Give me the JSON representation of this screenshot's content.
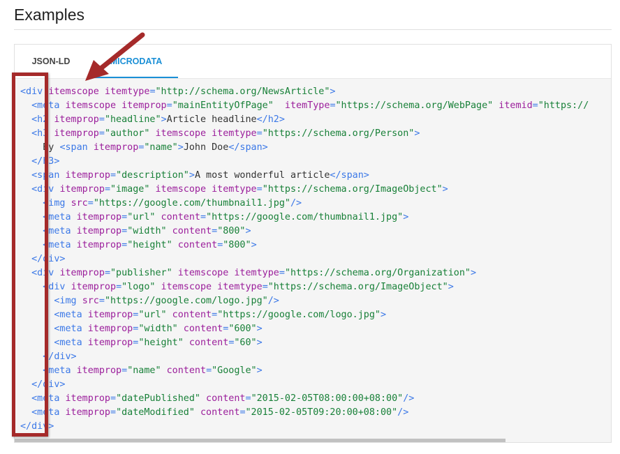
{
  "page": {
    "heading": "Examples"
  },
  "tabs": [
    {
      "label": "JSON-LD",
      "active": false
    },
    {
      "label": "MICRODATA",
      "active": true
    }
  ],
  "code_lines": [
    [
      {
        "c": "tg",
        "t": "<div "
      },
      {
        "c": "at",
        "t": "itemscope itemtype"
      },
      {
        "c": "tg",
        "t": "="
      },
      {
        "c": "vl",
        "t": "\"http://schema.org/NewsArticle\""
      },
      {
        "c": "tg",
        "t": ">"
      }
    ],
    [
      {
        "c": "tg",
        "t": "  <meta "
      },
      {
        "c": "at",
        "t": "itemscope itemprop"
      },
      {
        "c": "tg",
        "t": "="
      },
      {
        "c": "vl",
        "t": "\"mainEntityOfPage\""
      },
      {
        "c": "at",
        "t": "  itemType"
      },
      {
        "c": "tg",
        "t": "="
      },
      {
        "c": "vl",
        "t": "\"https://schema.org/WebPage\""
      },
      {
        "c": "at",
        "t": " itemid"
      },
      {
        "c": "tg",
        "t": "="
      },
      {
        "c": "vl",
        "t": "\"https://"
      }
    ],
    [
      {
        "c": "tg",
        "t": "  <h2 "
      },
      {
        "c": "at",
        "t": "itemprop"
      },
      {
        "c": "tg",
        "t": "="
      },
      {
        "c": "vl",
        "t": "\"headline\""
      },
      {
        "c": "tg",
        "t": ">"
      },
      {
        "c": "",
        "t": "Article headline"
      },
      {
        "c": "tg",
        "t": "</h2>"
      }
    ],
    [
      {
        "c": "tg",
        "t": "  <h3 "
      },
      {
        "c": "at",
        "t": "itemprop"
      },
      {
        "c": "tg",
        "t": "="
      },
      {
        "c": "vl",
        "t": "\"author\""
      },
      {
        "c": "at",
        "t": " itemscope itemtype"
      },
      {
        "c": "tg",
        "t": "="
      },
      {
        "c": "vl",
        "t": "\"https://schema.org/Person\""
      },
      {
        "c": "tg",
        "t": ">"
      }
    ],
    [
      {
        "c": "",
        "t": "    By "
      },
      {
        "c": "tg",
        "t": "<span "
      },
      {
        "c": "at",
        "t": "itemprop"
      },
      {
        "c": "tg",
        "t": "="
      },
      {
        "c": "vl",
        "t": "\"name\""
      },
      {
        "c": "tg",
        "t": ">"
      },
      {
        "c": "",
        "t": "John Doe"
      },
      {
        "c": "tg",
        "t": "</span>"
      }
    ],
    [
      {
        "c": "tg",
        "t": "  </h3>"
      }
    ],
    [
      {
        "c": "tg",
        "t": "  <span "
      },
      {
        "c": "at",
        "t": "itemprop"
      },
      {
        "c": "tg",
        "t": "="
      },
      {
        "c": "vl",
        "t": "\"description\""
      },
      {
        "c": "tg",
        "t": ">"
      },
      {
        "c": "",
        "t": "A most wonderful article"
      },
      {
        "c": "tg",
        "t": "</span>"
      }
    ],
    [
      {
        "c": "tg",
        "t": "  <div "
      },
      {
        "c": "at",
        "t": "itemprop"
      },
      {
        "c": "tg",
        "t": "="
      },
      {
        "c": "vl",
        "t": "\"image\""
      },
      {
        "c": "at",
        "t": " itemscope itemtype"
      },
      {
        "c": "tg",
        "t": "="
      },
      {
        "c": "vl",
        "t": "\"https://schema.org/ImageObject\""
      },
      {
        "c": "tg",
        "t": ">"
      }
    ],
    [
      {
        "c": "tg",
        "t": "    <img "
      },
      {
        "c": "at",
        "t": "src"
      },
      {
        "c": "tg",
        "t": "="
      },
      {
        "c": "vl",
        "t": "\"https://google.com/thumbnail1.jpg\""
      },
      {
        "c": "tg",
        "t": "/>"
      }
    ],
    [
      {
        "c": "tg",
        "t": "    <meta "
      },
      {
        "c": "at",
        "t": "itemprop"
      },
      {
        "c": "tg",
        "t": "="
      },
      {
        "c": "vl",
        "t": "\"url\""
      },
      {
        "c": "at",
        "t": " content"
      },
      {
        "c": "tg",
        "t": "="
      },
      {
        "c": "vl",
        "t": "\"https://google.com/thumbnail1.jpg\""
      },
      {
        "c": "tg",
        "t": ">"
      }
    ],
    [
      {
        "c": "tg",
        "t": "    <meta "
      },
      {
        "c": "at",
        "t": "itemprop"
      },
      {
        "c": "tg",
        "t": "="
      },
      {
        "c": "vl",
        "t": "\"width\""
      },
      {
        "c": "at",
        "t": " content"
      },
      {
        "c": "tg",
        "t": "="
      },
      {
        "c": "vl",
        "t": "\"800\""
      },
      {
        "c": "tg",
        "t": ">"
      }
    ],
    [
      {
        "c": "tg",
        "t": "    <meta "
      },
      {
        "c": "at",
        "t": "itemprop"
      },
      {
        "c": "tg",
        "t": "="
      },
      {
        "c": "vl",
        "t": "\"height\""
      },
      {
        "c": "at",
        "t": " content"
      },
      {
        "c": "tg",
        "t": "="
      },
      {
        "c": "vl",
        "t": "\"800\""
      },
      {
        "c": "tg",
        "t": ">"
      }
    ],
    [
      {
        "c": "tg",
        "t": "  </div>"
      }
    ],
    [
      {
        "c": "tg",
        "t": "  <div "
      },
      {
        "c": "at",
        "t": "itemprop"
      },
      {
        "c": "tg",
        "t": "="
      },
      {
        "c": "vl",
        "t": "\"publisher\""
      },
      {
        "c": "at",
        "t": " itemscope itemtype"
      },
      {
        "c": "tg",
        "t": "="
      },
      {
        "c": "vl",
        "t": "\"https://schema.org/Organization\""
      },
      {
        "c": "tg",
        "t": ">"
      }
    ],
    [
      {
        "c": "tg",
        "t": "    <div "
      },
      {
        "c": "at",
        "t": "itemprop"
      },
      {
        "c": "tg",
        "t": "="
      },
      {
        "c": "vl",
        "t": "\"logo\""
      },
      {
        "c": "at",
        "t": " itemscope itemtype"
      },
      {
        "c": "tg",
        "t": "="
      },
      {
        "c": "vl",
        "t": "\"https://schema.org/ImageObject\""
      },
      {
        "c": "tg",
        "t": ">"
      }
    ],
    [
      {
        "c": "tg",
        "t": "      <img "
      },
      {
        "c": "at",
        "t": "src"
      },
      {
        "c": "tg",
        "t": "="
      },
      {
        "c": "vl",
        "t": "\"https://google.com/logo.jpg\""
      },
      {
        "c": "tg",
        "t": "/>"
      }
    ],
    [
      {
        "c": "tg",
        "t": "      <meta "
      },
      {
        "c": "at",
        "t": "itemprop"
      },
      {
        "c": "tg",
        "t": "="
      },
      {
        "c": "vl",
        "t": "\"url\""
      },
      {
        "c": "at",
        "t": " content"
      },
      {
        "c": "tg",
        "t": "="
      },
      {
        "c": "vl",
        "t": "\"https://google.com/logo.jpg\""
      },
      {
        "c": "tg",
        "t": ">"
      }
    ],
    [
      {
        "c": "tg",
        "t": "      <meta "
      },
      {
        "c": "at",
        "t": "itemprop"
      },
      {
        "c": "tg",
        "t": "="
      },
      {
        "c": "vl",
        "t": "\"width\""
      },
      {
        "c": "at",
        "t": " content"
      },
      {
        "c": "tg",
        "t": "="
      },
      {
        "c": "vl",
        "t": "\"600\""
      },
      {
        "c": "tg",
        "t": ">"
      }
    ],
    [
      {
        "c": "tg",
        "t": "      <meta "
      },
      {
        "c": "at",
        "t": "itemprop"
      },
      {
        "c": "tg",
        "t": "="
      },
      {
        "c": "vl",
        "t": "\"height\""
      },
      {
        "c": "at",
        "t": " content"
      },
      {
        "c": "tg",
        "t": "="
      },
      {
        "c": "vl",
        "t": "\"60\""
      },
      {
        "c": "tg",
        "t": ">"
      }
    ],
    [
      {
        "c": "tg",
        "t": "    </div>"
      }
    ],
    [
      {
        "c": "tg",
        "t": "    <meta "
      },
      {
        "c": "at",
        "t": "itemprop"
      },
      {
        "c": "tg",
        "t": "="
      },
      {
        "c": "vl",
        "t": "\"name\""
      },
      {
        "c": "at",
        "t": " content"
      },
      {
        "c": "tg",
        "t": "="
      },
      {
        "c": "vl",
        "t": "\"Google\""
      },
      {
        "c": "tg",
        "t": ">"
      }
    ],
    [
      {
        "c": "tg",
        "t": "  </div>"
      }
    ],
    [
      {
        "c": "tg",
        "t": "  <meta "
      },
      {
        "c": "at",
        "t": "itemprop"
      },
      {
        "c": "tg",
        "t": "="
      },
      {
        "c": "vl",
        "t": "\"datePublished\""
      },
      {
        "c": "at",
        "t": " content"
      },
      {
        "c": "tg",
        "t": "="
      },
      {
        "c": "vl",
        "t": "\"2015-02-05T08:00:00+08:00\""
      },
      {
        "c": "tg",
        "t": "/>"
      }
    ],
    [
      {
        "c": "tg",
        "t": "  <meta "
      },
      {
        "c": "at",
        "t": "itemprop"
      },
      {
        "c": "tg",
        "t": "="
      },
      {
        "c": "vl",
        "t": "\"dateModified\""
      },
      {
        "c": "at",
        "t": " content"
      },
      {
        "c": "tg",
        "t": "="
      },
      {
        "c": "vl",
        "t": "\"2015-02-05T09:20:00+08:00\""
      },
      {
        "c": "tg",
        "t": "/>"
      }
    ],
    [
      {
        "c": "tg",
        "t": "</div>"
      }
    ]
  ],
  "colors": {
    "tag": "#3b78e7",
    "attr": "#9b1e9b",
    "value": "#188038",
    "accent": "#1a8fd6",
    "annotation": "#a52a2a"
  },
  "annotations": {
    "icons": [
      "red-arrow-icon",
      "red-highlight-box"
    ]
  }
}
